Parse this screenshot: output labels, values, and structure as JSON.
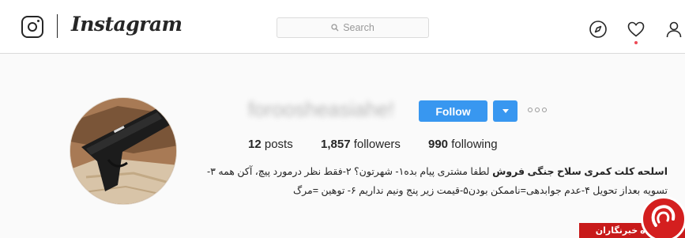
{
  "header": {
    "brand": "Instagram",
    "search": {
      "placeholder": "Search"
    },
    "icons": [
      "instagram-camera-icon",
      "compass-icon",
      "heart-icon",
      "user-icon"
    ]
  },
  "profile": {
    "username": "foroosheasiahe!",
    "follow_label": "Follow",
    "stats": {
      "posts_count": "12",
      "posts_label": "posts",
      "followers_count": "1,857",
      "followers_label": "followers",
      "following_count": "990",
      "following_label": "following"
    },
    "bio": {
      "name": "اسلحه کلت کمری سلاح جنگی فروش",
      "line1": " لطفا مشتری پیام بده۱- شهرتون؟ ۲-فقط نظر درمورد پیچ، آکن همه ۳-",
      "line2": "تسویه بعداز تحویل ۴-عدم جوابدهی=ناممکن بودن۵-قیمت زیر پنج ونیم نداریم ۶- توهین =مرگ"
    }
  },
  "watermark": {
    "text": "باشگاه خبرنگاران"
  },
  "colors": {
    "follow_blue": "#3897f0",
    "notification_red": "#ed4956",
    "watermark_red": "#c81a1a"
  }
}
